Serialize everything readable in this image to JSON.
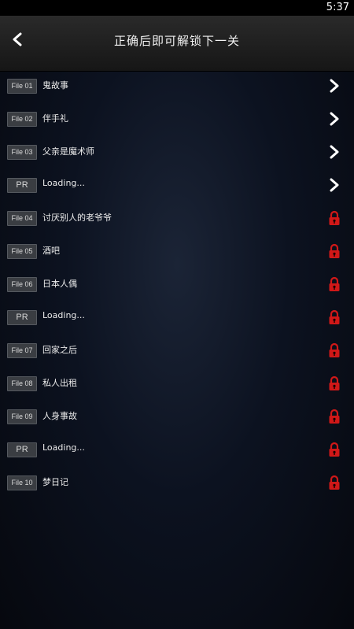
{
  "status": {
    "time": "5:37"
  },
  "header": {
    "title": "正确后即可解锁下一关"
  },
  "colors": {
    "lock": "#d01818",
    "chevron": "#ffffff",
    "badge_bg": "#3a3d42"
  },
  "items": [
    {
      "badge": "File 01",
      "title": "鬼故事",
      "state": "unlocked",
      "icon": "chevron-right-icon"
    },
    {
      "badge": "File 02",
      "title": "伴手礼",
      "state": "unlocked",
      "icon": "chevron-right-icon"
    },
    {
      "badge": "File 03",
      "title": "父亲是魔术师",
      "state": "unlocked",
      "icon": "chevron-right-icon"
    },
    {
      "badge": "PR",
      "title": "Loading...",
      "state": "unlocked",
      "icon": "chevron-right-icon"
    },
    {
      "badge": "File 04",
      "title": "讨厌别人的老爷爷",
      "state": "locked",
      "icon": "lock-icon"
    },
    {
      "badge": "File 05",
      "title": "酒吧",
      "state": "locked",
      "icon": "lock-icon"
    },
    {
      "badge": "File 06",
      "title": "日本人偶",
      "state": "locked",
      "icon": "lock-icon"
    },
    {
      "badge": "PR",
      "title": "Loading...",
      "state": "locked",
      "icon": "lock-icon"
    },
    {
      "badge": "File 07",
      "title": "回家之后",
      "state": "locked",
      "icon": "lock-icon"
    },
    {
      "badge": "File 08",
      "title": "私人出租",
      "state": "locked",
      "icon": "lock-icon"
    },
    {
      "badge": "File 09",
      "title": "人身事故",
      "state": "locked",
      "icon": "lock-icon"
    },
    {
      "badge": "PR",
      "title": "Loading...",
      "state": "locked",
      "icon": "lock-icon"
    },
    {
      "badge": "File 10",
      "title": "梦日记",
      "state": "locked",
      "icon": "lock-icon"
    }
  ]
}
